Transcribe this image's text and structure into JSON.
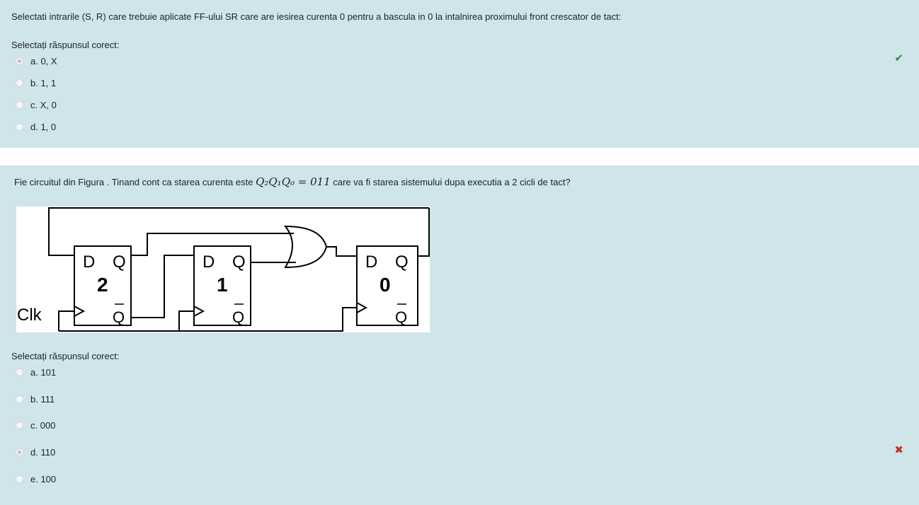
{
  "q1": {
    "text": "Selectati intrarile (S, R) care trebuie aplicate FF-ului SR care are iesirea curenta 0 pentru a bascula in 0 la intalnirea proximului front crescator de tact:",
    "prompt": "Selectați răspunsul corect:",
    "options": [
      {
        "label": "a. 0, X",
        "checked": true
      },
      {
        "label": "b. 1, 1",
        "checked": false
      },
      {
        "label": "c. X, 0",
        "checked": false
      },
      {
        "label": "d. 1, 0",
        "checked": false
      }
    ],
    "feedback_icon": "check-icon"
  },
  "q2": {
    "text_before": "Fie circuitul din Figura . Tinand cont ca starea curenta este",
    "math": "Q₂Q₁Q₀ = 011",
    "text_after": "care va fi starea sistemului dupa executia a 2 cicli de tact?",
    "figure": {
      "clk_label": "Clk",
      "ff": [
        {
          "d": "D",
          "q": "Q",
          "num": "2",
          "qbar": "Q"
        },
        {
          "d": "D",
          "q": "Q",
          "num": "1",
          "qbar": "Q"
        },
        {
          "d": "D",
          "q": "Q",
          "num": "0",
          "qbar": "Q"
        }
      ]
    },
    "prompt": "Selectați răspunsul corect:",
    "options": [
      {
        "label": "a.  101",
        "checked": false
      },
      {
        "label": "b. 111",
        "checked": false
      },
      {
        "label": "c. 000",
        "checked": false
      },
      {
        "label": "d. 110",
        "checked": true
      },
      {
        "label": "e. 100",
        "checked": false
      }
    ],
    "feedback_icon": "cross-icon"
  }
}
